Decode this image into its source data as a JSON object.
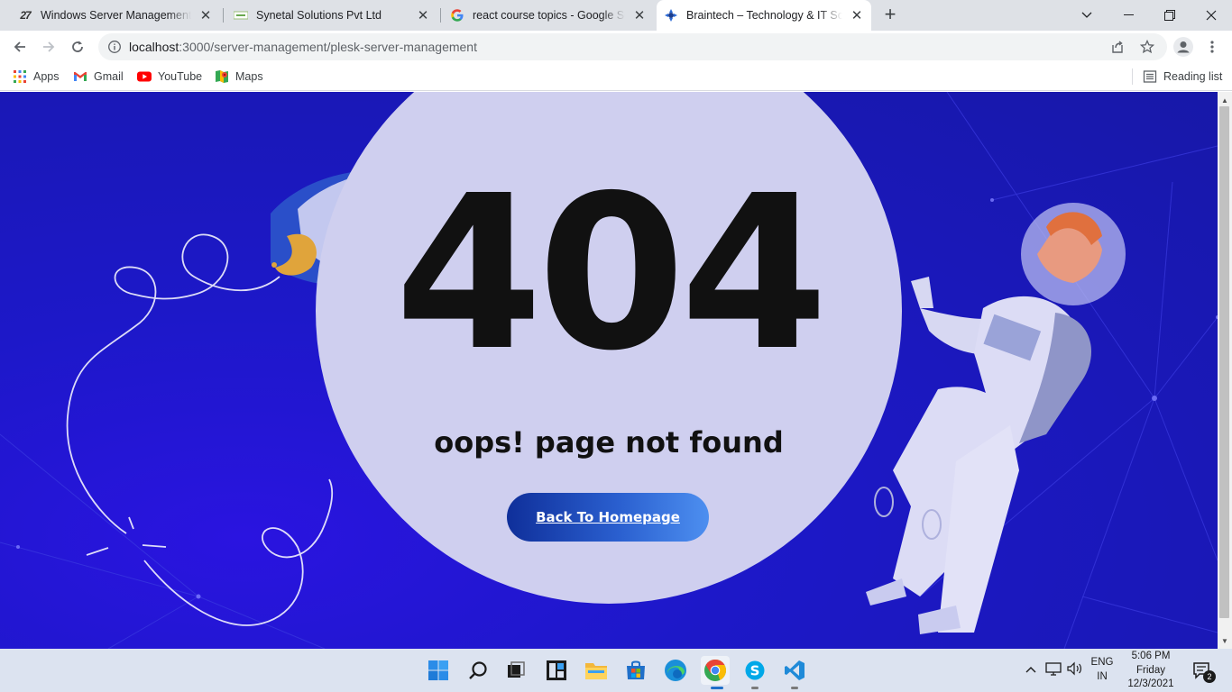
{
  "browser": {
    "tabs": [
      {
        "title": "Windows Server Management - P",
        "favicon": "27-logo-icon"
      },
      {
        "title": "Synetal Solutions Pvt Ltd",
        "favicon": "synetal-logo-icon"
      },
      {
        "title": "react course topics - Google Sear",
        "favicon": "google-g-icon"
      },
      {
        "title": "Braintech – Technology & IT Solu",
        "favicon": "braintech-logo-icon"
      }
    ],
    "active_tab_index": 3,
    "url_host": "localhost",
    "url_path": ":3000/server-management/plesk-server-management",
    "bookmarks": [
      {
        "label": "Apps",
        "icon": "apps-grid-icon"
      },
      {
        "label": "Gmail",
        "icon": "gmail-icon"
      },
      {
        "label": "YouTube",
        "icon": "youtube-icon"
      },
      {
        "label": "Maps",
        "icon": "maps-icon"
      }
    ],
    "reading_list_label": "Reading list"
  },
  "page": {
    "error_code": "404",
    "message": "oops! page not found",
    "button_label": "Back To Homepage",
    "colors": {
      "background": "#1d18c9",
      "circle": "#cfcfef",
      "text": "#111111",
      "button_start": "#0f2f9a",
      "button_end": "#4d8ff0"
    }
  },
  "taskbar": {
    "apps": [
      "windows-start-icon",
      "search-icon",
      "task-view-icon",
      "widgets-icon",
      "file-explorer-icon",
      "microsoft-store-icon",
      "edge-icon",
      "chrome-icon",
      "skype-icon",
      "vscode-icon"
    ],
    "language_line1": "ENG",
    "language_line2": "IN",
    "time": "5:06 PM",
    "day": "Friday",
    "date": "12/3/2021",
    "notification_count": "2"
  }
}
